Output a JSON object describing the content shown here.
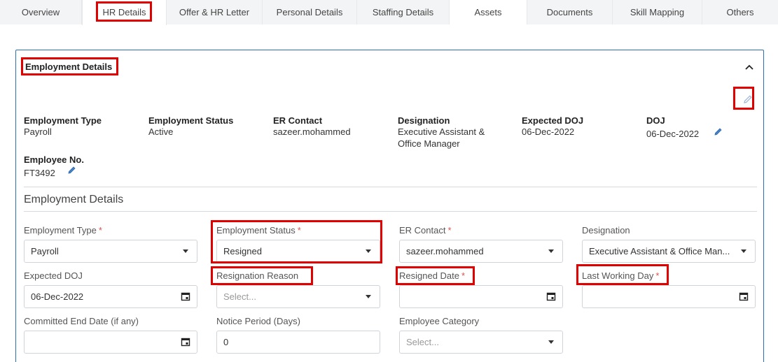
{
  "tabs": [
    {
      "label": "Overview"
    },
    {
      "label": "HR Details"
    },
    {
      "label": "Offer & HR Letter"
    },
    {
      "label": "Personal Details"
    },
    {
      "label": "Staffing Details"
    },
    {
      "label": "Assets"
    },
    {
      "label": "Documents"
    },
    {
      "label": "Skill Mapping"
    },
    {
      "label": "Others"
    }
  ],
  "card": {
    "title": "Employment Details",
    "summary": [
      {
        "label": "Employment Type",
        "value": "Payroll"
      },
      {
        "label": "Employment Status",
        "value": "Active"
      },
      {
        "label": "ER Contact",
        "value": "sazeer.mohammed"
      },
      {
        "label": "Designation",
        "value": "Executive Assistant & Office Manager"
      },
      {
        "label": "Expected DOJ",
        "value": "06-Dec-2022"
      },
      {
        "label": "DOJ",
        "value": "06-Dec-2022"
      },
      {
        "label": "Employee No.",
        "value": "FT3492"
      }
    ],
    "section_title": "Employment Details",
    "fields": {
      "employment_type": {
        "label": "Employment Type",
        "required": "*",
        "value": "Payroll"
      },
      "employment_status": {
        "label": "Employment Status",
        "required": "*",
        "value": "Resigned"
      },
      "er_contact": {
        "label": "ER Contact",
        "required": "*",
        "value": "sazeer.mohammed"
      },
      "designation": {
        "label": "Designation",
        "value": "Executive Assistant & Office Man..."
      },
      "expected_doj": {
        "label": "Expected DOJ",
        "value": "06-Dec-2022"
      },
      "resignation_reason": {
        "label": "Resignation Reason",
        "placeholder": "Select..."
      },
      "resigned_date": {
        "label": "Resigned Date",
        "required": "*",
        "value": ""
      },
      "last_working_day": {
        "label": "Last Working Day",
        "required": "*",
        "value": ""
      },
      "committed_end_date": {
        "label": "Committed End Date (if any)",
        "value": ""
      },
      "notice_period": {
        "label": "Notice Period (Days)",
        "value": "0"
      },
      "employee_category": {
        "label": "Employee Category",
        "placeholder": "Select..."
      }
    }
  },
  "colors": {
    "accent": "#2d6fb5",
    "highlight": "#e00000",
    "required": "#d9534f"
  },
  "icons": {
    "collapse": "chevron-up-icon",
    "edit": "pencil-icon",
    "calendar": "calendar-icon",
    "dropdown": "caret-down-icon"
  }
}
